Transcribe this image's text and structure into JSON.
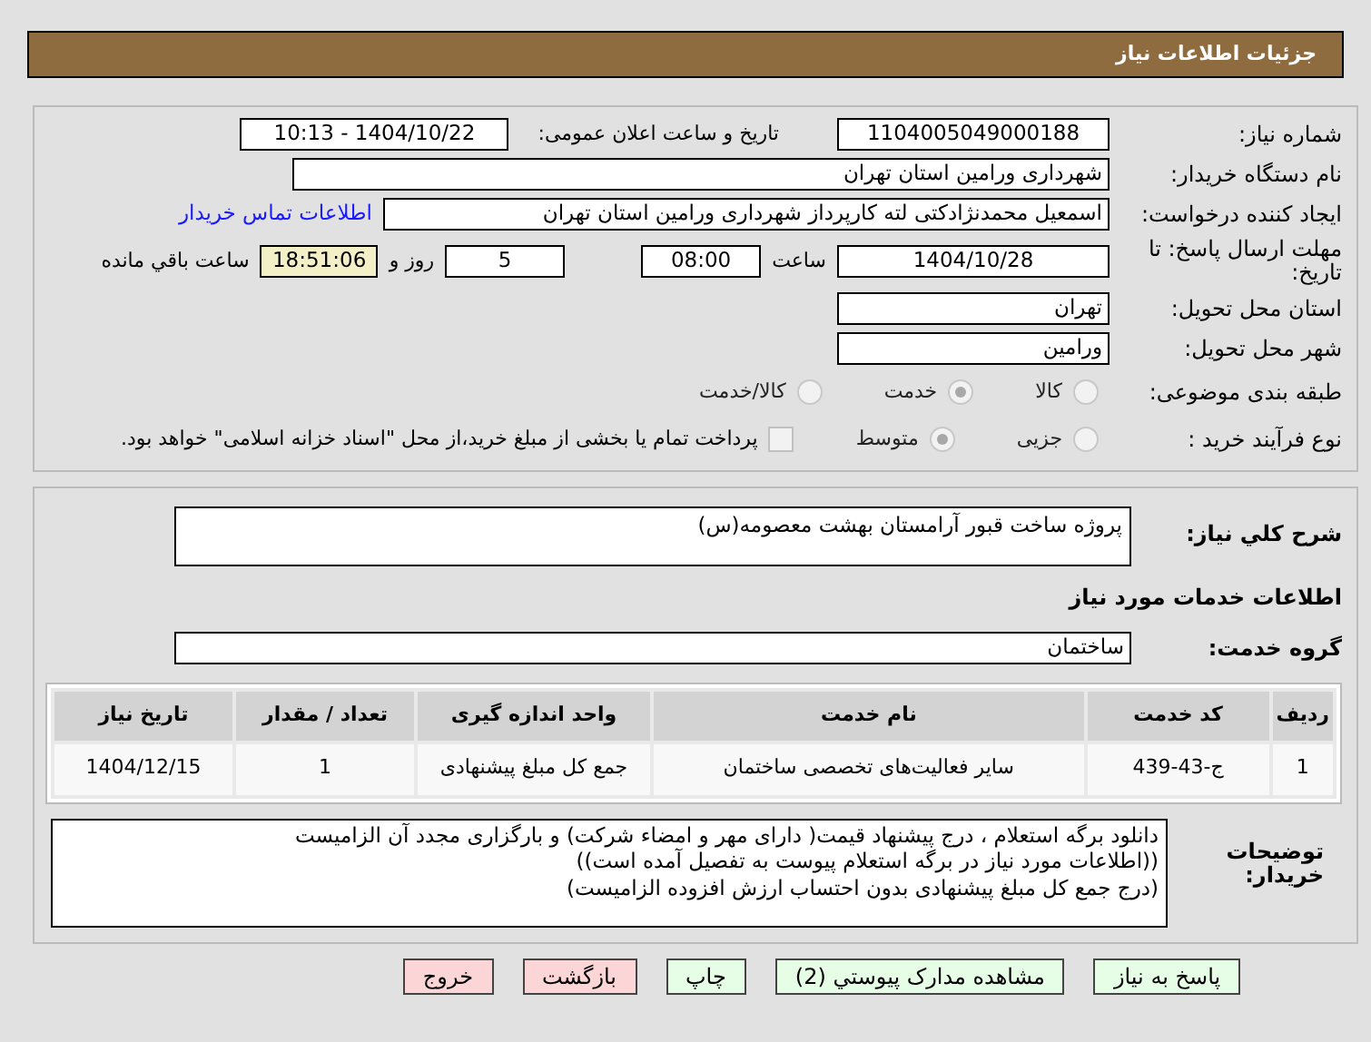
{
  "header": {
    "title": "جزئیات اطلاعات نیاز"
  },
  "need_number": {
    "label": "شماره نیاز:",
    "value": "1104005049000188"
  },
  "announce_date": {
    "label": "تاریخ و ساعت اعلان عمومی:",
    "value": "1404/10/22 - 10:13"
  },
  "buyer_org": {
    "label": "نام دستگاه خریدار:",
    "value": "شهرداری ورامین استان تهران"
  },
  "requester": {
    "label": "ایجاد کننده درخواست:",
    "value": "اسمعیل محمدنژادکتی لته کارپرداز شهرداری ورامین استان تهران",
    "link": "اطلاعات تماس خریدار"
  },
  "deadline": {
    "label": "مهلت ارسال پاسخ: تا تاریخ:",
    "date": "1404/10/28",
    "time_label": "ساعت",
    "time": "08:00",
    "days": "5",
    "days_label": "روز و",
    "remaining": "18:51:06",
    "remaining_label": "ساعت باقي مانده"
  },
  "province": {
    "label": "استان محل تحویل:",
    "value": "تهران"
  },
  "city": {
    "label": "شهر محل تحویل:",
    "value": "ورامین"
  },
  "category": {
    "label": "طبقه بندی موضوعی:",
    "options": [
      {
        "label": "کالا",
        "selected": false
      },
      {
        "label": "خدمت",
        "selected": true
      },
      {
        "label": "کالا/خدمت",
        "selected": false
      }
    ]
  },
  "process": {
    "label": "نوع فرآیند خرید :",
    "options": [
      {
        "label": "جزیی",
        "selected": false
      },
      {
        "label": "متوسط",
        "selected": true
      }
    ],
    "payment": {
      "label": "پرداخت تمام یا بخشی از مبلغ خرید،از محل \"اسناد خزانه اسلامی\" خواهد بود.",
      "checked": false
    }
  },
  "description": {
    "label": "شرح کلي نياز:",
    "value": "پروژه ساخت قبور آرامستان بهشت معصومه(س)"
  },
  "services_title": "اطلاعات خدمات مورد نیاز",
  "service_group": {
    "label": "گروه خدمت:",
    "value": "ساختمان"
  },
  "table": {
    "columns": [
      "ردیف",
      "کد خدمت",
      "نام خدمت",
      "واحد اندازه گیری",
      "تعداد / مقدار",
      "تاریخ نیاز"
    ],
    "rows": [
      [
        "1",
        "ج-43-439",
        "سایر فعالیت‌های تخصصی ساختمان",
        "جمع کل مبلغ پیشنهادی",
        "1",
        "1404/12/15"
      ]
    ]
  },
  "buyer_notes": {
    "label": "توضیحات خریدار:",
    "lines": [
      "دانلود برگه استعلام ، درج پیشنهاد قیمت( دارای مهر و امضاء شرکت) و بارگزاری مجدد آن الزامیست",
      "((اطلاعات مورد نیاز در برگه استعلام پیوست به تفصیل آمده است))",
      "(درج  جمع کل مبلغ پیشنهادی بدون احتساب ارزش افزوده الزامیست)"
    ]
  },
  "buttons": [
    {
      "label": "پاسخ به نیاز",
      "kind": "action"
    },
    {
      "label": "مشاهده مدارک پیوستي (2)",
      "kind": "action"
    },
    {
      "label": "چاپ",
      "kind": "action"
    },
    {
      "label": "بازگشت",
      "kind": "exit"
    },
    {
      "label": "خروج",
      "kind": "exit"
    }
  ]
}
